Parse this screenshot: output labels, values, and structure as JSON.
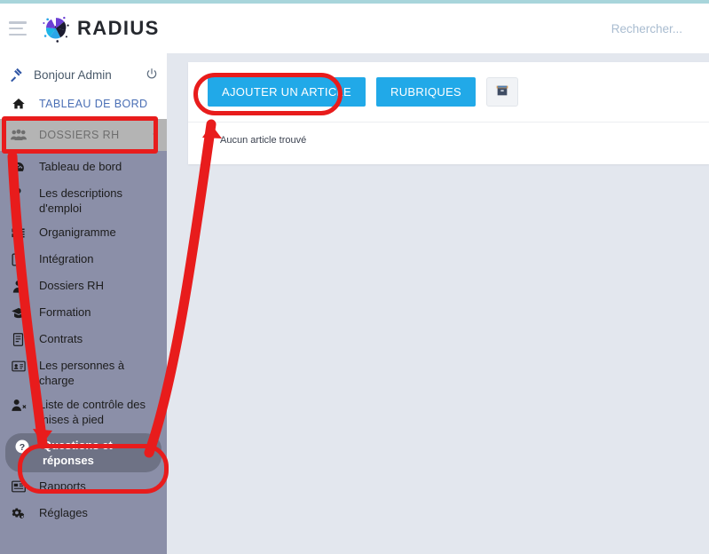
{
  "header": {
    "menu_icon": "hamburger-icon",
    "brand": "RADIUS",
    "search_placeholder": "Rechercher..."
  },
  "sidebar": {
    "greeting": "Bonjour Admin",
    "greeting_icon": "gavel-icon",
    "logout_icon": "power-icon",
    "dashboard": {
      "label": "TABLEAU DE BORD",
      "icon": "home-icon"
    },
    "group": {
      "label": "DOSSIERS RH",
      "icon": "users-group-icon",
      "chevron": "chevron-down-icon",
      "expanded": true
    },
    "items": [
      {
        "label": "Tableau de bord",
        "icon": "speedometer-icon",
        "active": false
      },
      {
        "label": "Les descriptions d'emploi",
        "icon": "map-pin-icon",
        "active": false
      },
      {
        "label": "Organigramme",
        "icon": "list-icon",
        "active": false
      },
      {
        "label": "Intégration",
        "icon": "edit-square-icon",
        "active": false
      },
      {
        "label": "Dossiers RH",
        "icon": "user-icon",
        "active": false
      },
      {
        "label": "Formation",
        "icon": "graduation-cap-icon",
        "active": false
      },
      {
        "label": "Contrats",
        "icon": "contract-icon",
        "active": false
      },
      {
        "label": "Les personnes à charge",
        "icon": "id-card-icon",
        "active": false
      },
      {
        "label": "Liste de contrôle des mises à pied",
        "icon": "user-remove-icon",
        "active": false
      },
      {
        "label": "Questions et réponses",
        "icon": "question-circle-icon",
        "active": true
      },
      {
        "label": "Rapports",
        "icon": "report-icon",
        "active": false
      },
      {
        "label": "Réglages",
        "icon": "gears-icon",
        "active": false
      }
    ]
  },
  "main": {
    "toolbar": {
      "add_article_label": "AJOUTER UN ARTICLE",
      "categories_label": "RUBRIQUES",
      "archive_icon": "archive-box-icon"
    },
    "empty_message": "Aucun article trouvé"
  },
  "annotations": {
    "highlight_color": "#e81c1c",
    "boxes": [
      {
        "name": "dossiers-rh-highlight",
        "target": "DOSSIERS RH"
      },
      {
        "name": "questions-reponses-highlight",
        "target": "Questions et réponses"
      },
      {
        "name": "ajouter-article-highlight",
        "target": "AJOUTER UN ARTICLE"
      }
    ],
    "arrows": [
      {
        "name": "arrow-dossiers-to-questions",
        "from": "DOSSIERS RH",
        "to": "Questions et réponses"
      },
      {
        "name": "arrow-questions-to-ajouter",
        "from": "Questions et réponses",
        "to": "AJOUTER UN ARTICLE"
      }
    ]
  },
  "colors": {
    "accent_blue": "#21a9e8",
    "sidebar_submenu": "#8b8fa8",
    "content_bg": "#e3e7ee",
    "top_strip": "#a8d5db"
  }
}
